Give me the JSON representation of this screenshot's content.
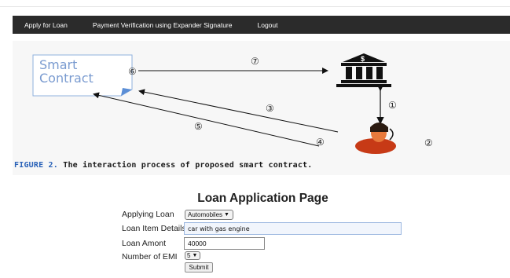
{
  "nav": {
    "items": [
      {
        "label": "Apply for Loan"
      },
      {
        "label": "Payment Verification using Expander Signature"
      },
      {
        "label": "Logout"
      }
    ]
  },
  "figure": {
    "smart_contract_line1": "Smart",
    "smart_contract_line2": "Contract",
    "steps": [
      "①",
      "②",
      "③",
      "④",
      "⑤",
      "⑥",
      "⑦"
    ],
    "caption_prefix": "FIGURE 2.",
    "caption_text": "The interaction process of proposed smart contract.",
    "icons": [
      "bank-icon",
      "person-icon",
      "document-icon"
    ]
  },
  "form": {
    "title": "Loan Application Page",
    "applying_loan_label": "Applying Loan",
    "applying_loan_value": "Automobiles",
    "item_details_label": "Loan Item Details",
    "item_details_value": "car with gas engine",
    "amount_label": "Loan Amont",
    "amount_value": "40000",
    "emi_label": "Number of EMI",
    "emi_value": "5",
    "submit_label": "Submit"
  },
  "colors": {
    "navbar": "#2b2b2b",
    "figure_blue": "#5b8ed6",
    "caption_blue": "#2a62b8"
  }
}
